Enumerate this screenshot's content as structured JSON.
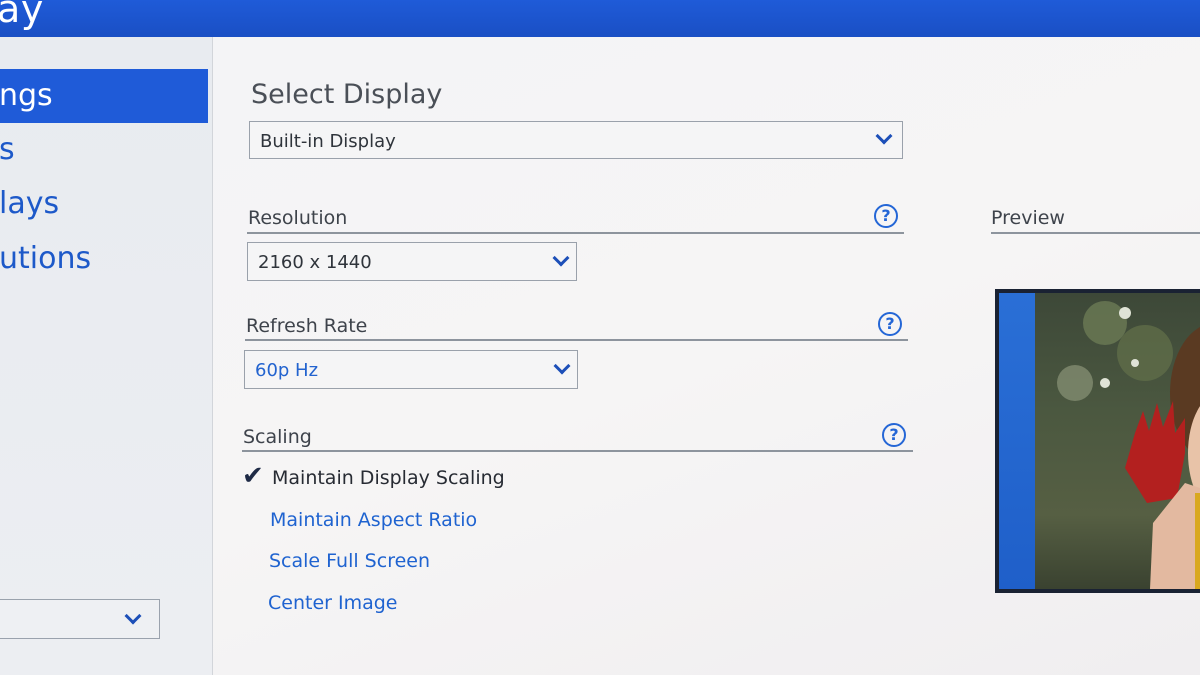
{
  "window": {
    "title_fragment": "lay"
  },
  "sidebar": {
    "items": [
      {
        "label": "ngs",
        "active": true
      },
      {
        "label": "s",
        "active": false
      },
      {
        "label": "lays",
        "active": false
      },
      {
        "label": "utions",
        "active": false
      }
    ]
  },
  "main": {
    "select_display": {
      "heading": "Select Display",
      "value": "Built-in Display"
    },
    "resolution": {
      "label": "Resolution",
      "value": "2160 x 1440"
    },
    "refresh_rate": {
      "label": "Refresh Rate",
      "value": "60p Hz"
    },
    "scaling": {
      "label": "Scaling",
      "options": [
        {
          "label": "Maintain Display Scaling",
          "checked": true
        },
        {
          "label": "Maintain Aspect Ratio",
          "checked": false
        },
        {
          "label": "Scale Full Screen",
          "checked": false
        },
        {
          "label": "Center Image",
          "checked": false
        }
      ]
    },
    "preview": {
      "label": "Preview"
    },
    "help_glyph": "?",
    "check_glyph": "✔"
  },
  "colors": {
    "accent": "#1f5bd8",
    "link": "#1f63d0",
    "text": "#3e434b"
  }
}
